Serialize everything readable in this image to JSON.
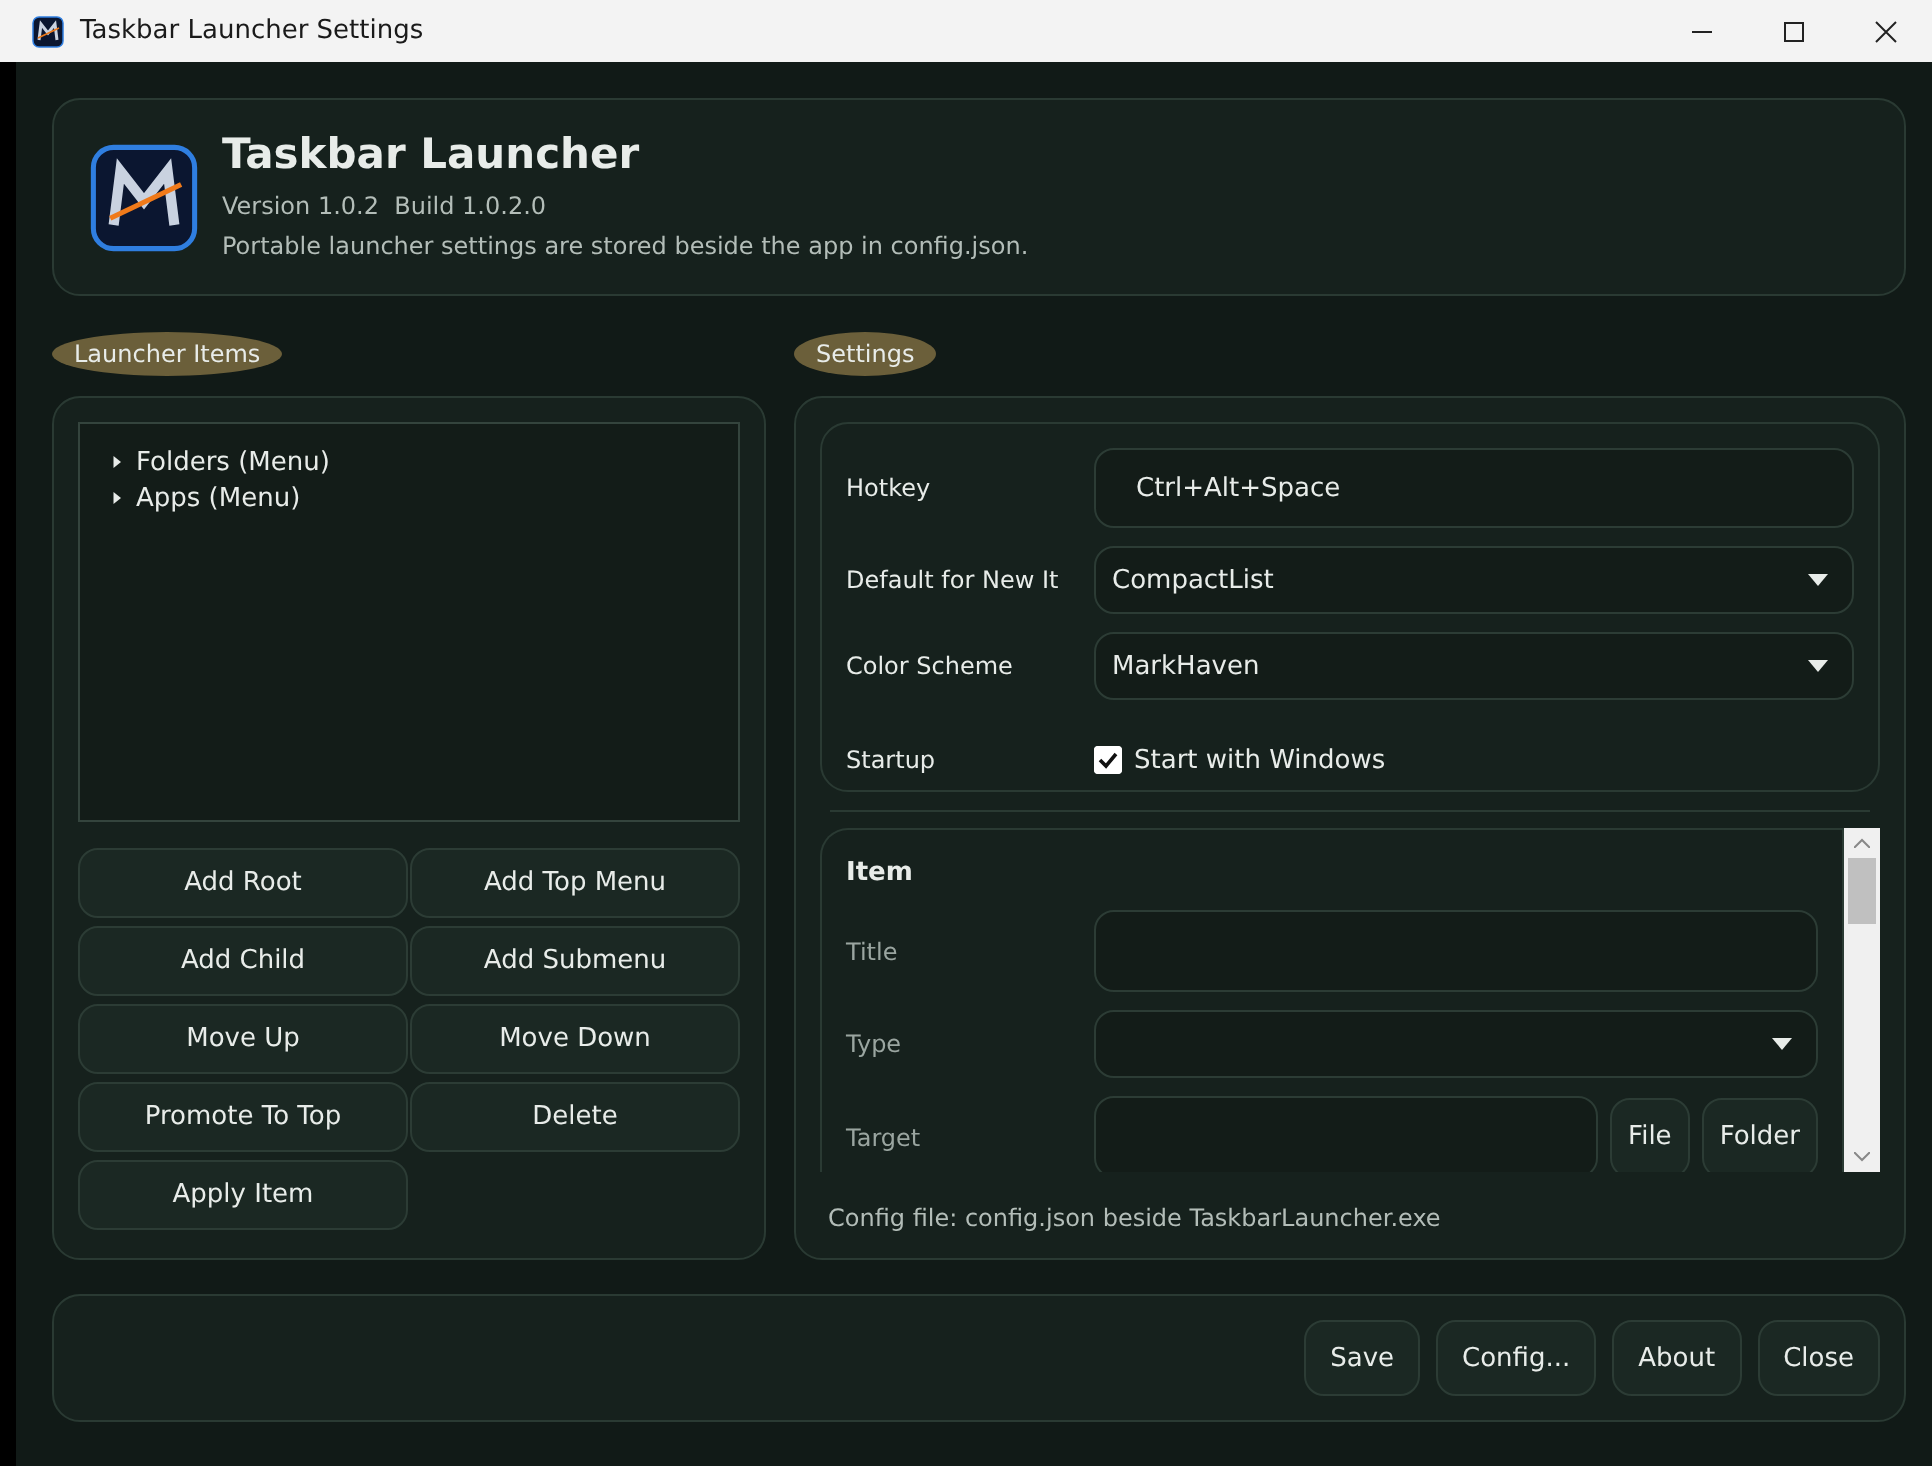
{
  "window": {
    "title": "Taskbar Launcher Settings"
  },
  "header": {
    "title": "Taskbar Launcher",
    "version": "Version 1.0.2  Build 1.0.2.0",
    "description": "Portable launcher settings are stored beside the app in config.json."
  },
  "launcher_items": {
    "label": "Launcher Items",
    "tree": [
      {
        "label": "Folders (Menu)",
        "expanded": false
      },
      {
        "label": "Apps (Menu)",
        "expanded": false
      }
    ],
    "buttons": [
      "Add Root",
      "Add Top Menu",
      "Add Child",
      "Add Submenu",
      "Move Up",
      "Move Down",
      "Promote To Top",
      "Delete",
      "Apply Item"
    ]
  },
  "settings": {
    "label": "Settings",
    "fields": [
      {
        "kind": "text",
        "label": "Hotkey",
        "value": "Ctrl+Alt+Space"
      },
      {
        "kind": "dropdown",
        "label": "Default for New It",
        "value": "CompactList"
      },
      {
        "kind": "dropdown",
        "label": "Color Scheme",
        "value": "MarkHaven"
      },
      {
        "kind": "checkbox",
        "label": "Startup",
        "text": "Start with Windows",
        "checked": true
      }
    ],
    "item": {
      "heading": "Item",
      "fields": [
        {
          "kind": "text",
          "label": "Title"
        },
        {
          "kind": "dropdown",
          "label": "Type"
        },
        {
          "kind": "path",
          "label": "Target",
          "buttons": [
            "File",
            "Folder"
          ]
        }
      ]
    },
    "config_note": "Config file: config.json beside TaskbarLauncher.exe"
  },
  "footer": {
    "buttons": [
      "Save",
      "Config...",
      "About",
      "Close"
    ]
  }
}
